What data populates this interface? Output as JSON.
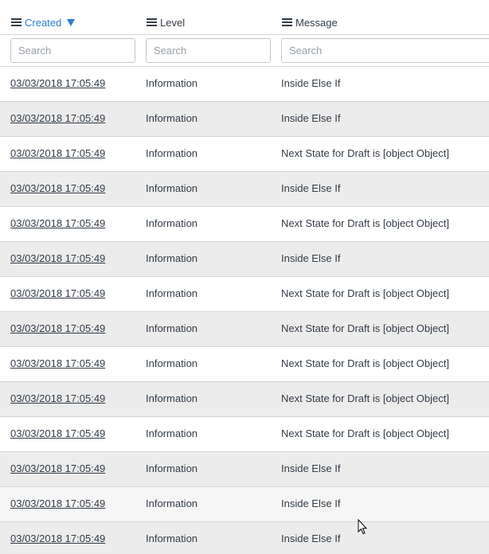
{
  "columns": {
    "created": {
      "label": "Created",
      "sorted": "descending"
    },
    "level": {
      "label": "Level"
    },
    "message": {
      "label": "Message"
    }
  },
  "search": {
    "created_placeholder": "Search",
    "level_placeholder": "Search",
    "message_placeholder": "Search"
  },
  "rows": [
    {
      "created": "03/03/2018 17:05:49",
      "level": "Information",
      "message": "Inside Else If"
    },
    {
      "created": "03/03/2018 17:05:49",
      "level": "Information",
      "message": "Inside Else If"
    },
    {
      "created": "03/03/2018 17:05:49",
      "level": "Information",
      "message": "Next State for Draft is [object Object]"
    },
    {
      "created": "03/03/2018 17:05:49",
      "level": "Information",
      "message": "Inside Else If"
    },
    {
      "created": "03/03/2018 17:05:49",
      "level": "Information",
      "message": "Next State for Draft is [object Object]"
    },
    {
      "created": "03/03/2018 17:05:49",
      "level": "Information",
      "message": "Inside Else If"
    },
    {
      "created": "03/03/2018 17:05:49",
      "level": "Information",
      "message": "Next State for Draft is [object Object]"
    },
    {
      "created": "03/03/2018 17:05:49",
      "level": "Information",
      "message": "Next State for Draft is [object Object]"
    },
    {
      "created": "03/03/2018 17:05:49",
      "level": "Information",
      "message": "Next State for Draft is [object Object]"
    },
    {
      "created": "03/03/2018 17:05:49",
      "level": "Information",
      "message": "Next State for Draft is [object Object]"
    },
    {
      "created": "03/03/2018 17:05:49",
      "level": "Information",
      "message": "Next State for Draft is [object Object]"
    },
    {
      "created": "03/03/2018 17:05:49",
      "level": "Information",
      "message": "Inside Else If"
    },
    {
      "created": "03/03/2018 17:05:49",
      "level": "Information",
      "message": "Inside Else If"
    },
    {
      "created": "03/03/2018 17:05:49",
      "level": "Information",
      "message": "Inside Else If"
    }
  ],
  "colors": {
    "sorted_header": "#2a7fd1",
    "text": "#343d47",
    "row_alt": "#ececec",
    "row_hover": "#f6f6f6",
    "border": "#d5d5d5"
  },
  "icons": {
    "column_menu": "hamburger-menu-icon",
    "sort": "sort-descending-icon",
    "cursor": "mouse-pointer-icon"
  }
}
